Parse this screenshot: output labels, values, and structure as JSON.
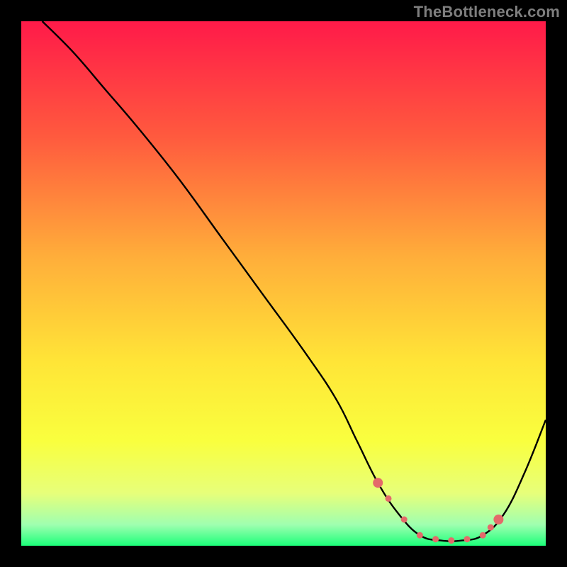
{
  "watermark": "TheBottleneck.com",
  "chart_data": {
    "type": "line",
    "title": "",
    "xlabel": "",
    "ylabel": "",
    "xlim": [
      0,
      100
    ],
    "ylim": [
      0,
      100
    ],
    "background_gradient": {
      "stops": [
        {
          "offset": 0.0,
          "color": "#ff1a49"
        },
        {
          "offset": 0.22,
          "color": "#ff5a3e"
        },
        {
          "offset": 0.45,
          "color": "#ffae3a"
        },
        {
          "offset": 0.65,
          "color": "#ffe537"
        },
        {
          "offset": 0.8,
          "color": "#f9ff3e"
        },
        {
          "offset": 0.9,
          "color": "#e7ff7a"
        },
        {
          "offset": 0.96,
          "color": "#9fffb0"
        },
        {
          "offset": 1.0,
          "color": "#1cff7a"
        }
      ]
    },
    "series": [
      {
        "name": "curve",
        "color": "#000000",
        "x": [
          4,
          10,
          16,
          22,
          30,
          38,
          46,
          54,
          60,
          64,
          68,
          72,
          76,
          80,
          84,
          88,
          92,
          96,
          100
        ],
        "values": [
          100,
          94,
          87,
          80,
          70,
          59,
          48,
          37,
          28,
          20,
          12,
          6,
          2,
          1,
          1,
          2,
          6,
          14,
          24
        ]
      }
    ],
    "markers": {
      "name": "highlight-points",
      "color": "#e46a6a",
      "radius": 4.5,
      "caps": {
        "radius": 7.0,
        "x": [
          68,
          91
        ]
      },
      "x": [
        70,
        73,
        76,
        79,
        82,
        85,
        88,
        89.5
      ],
      "y": [
        4.0,
        2.2,
        1.3,
        1.0,
        1.0,
        1.3,
        2.2,
        3.5
      ]
    }
  }
}
